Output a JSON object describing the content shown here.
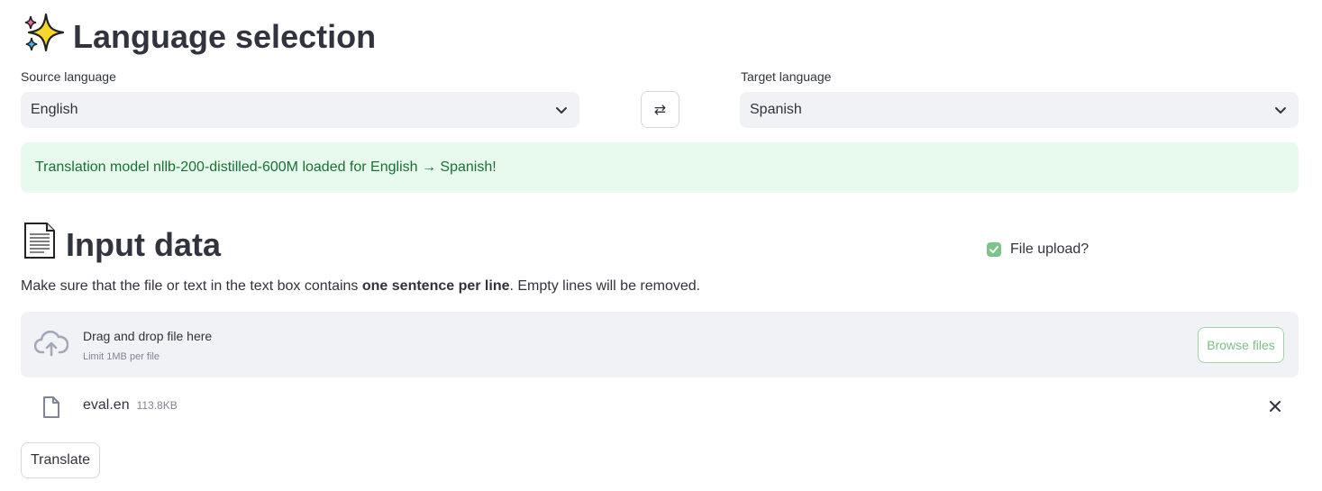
{
  "section1": {
    "title": "Language selection",
    "icon": "sparkles-icon"
  },
  "source": {
    "label": "Source language",
    "value": "English"
  },
  "swap": {
    "glyph": "⇄"
  },
  "target": {
    "label": "Target language",
    "value": "Spanish"
  },
  "alert": {
    "text": "Translation model nllb-200-distilled-600M loaded for English → Spanish!"
  },
  "section2": {
    "title": "Input data",
    "icon": "page-icon"
  },
  "file_toggle": {
    "label": "File upload?",
    "checked": true
  },
  "info": {
    "before": "Make sure that the file or text in the text box contains ",
    "bold": "one sentence per line",
    "after": ". Empty lines will be removed."
  },
  "uploader": {
    "title": "Drag and drop file here",
    "limit": "Limit 1MB per file",
    "browse_label": "Browse files"
  },
  "file": {
    "name": "eval.en",
    "size": "113.8KB"
  },
  "translate": {
    "label": "Translate"
  },
  "colors": {
    "alert_bg": "#e8f9ee",
    "alert_text": "#177233",
    "accent_green": "#7bbf86",
    "input_bg": "#f0f2f6"
  }
}
